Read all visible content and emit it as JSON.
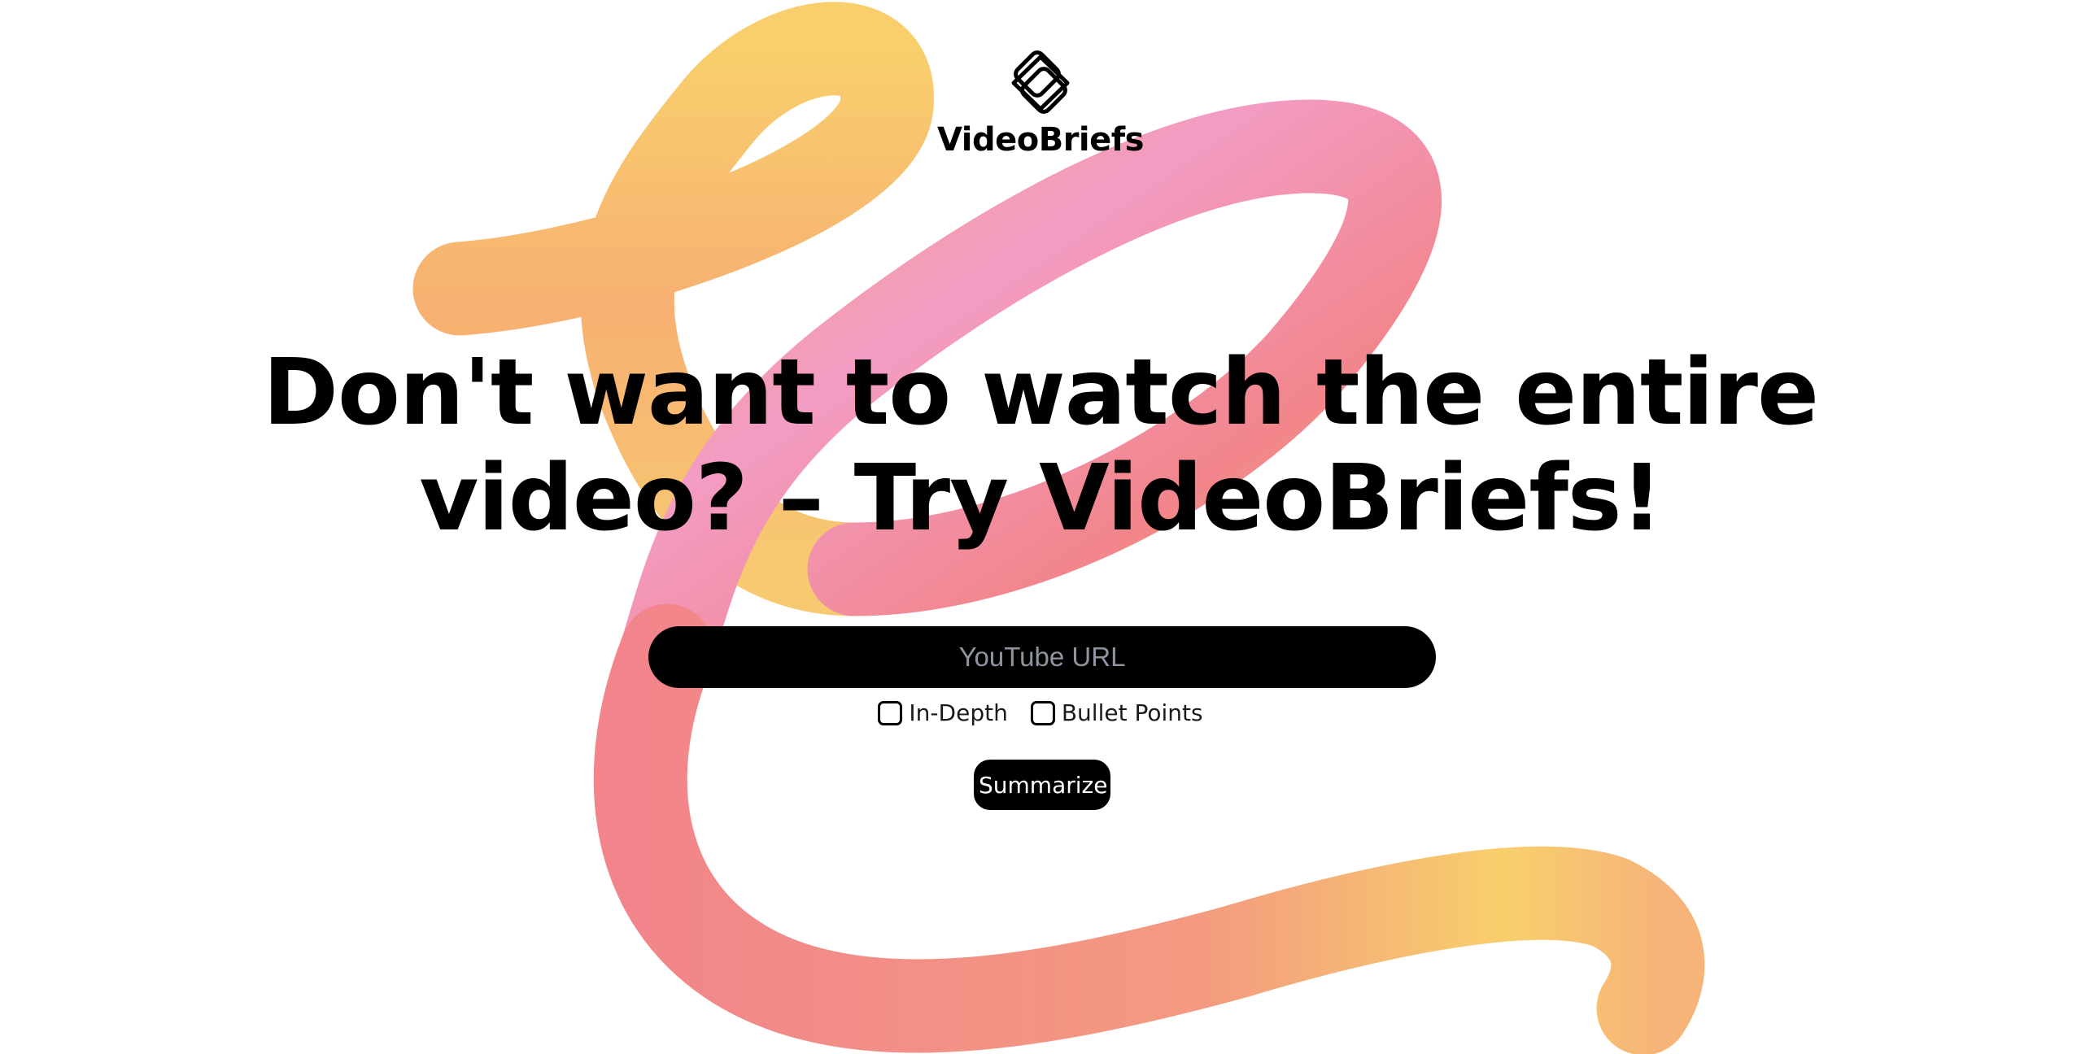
{
  "brand": {
    "logo_icon": "linked-diamonds-logo-icon",
    "name": "VideoBriefs"
  },
  "hero": {
    "headline_line1": "Don't want to watch the entire",
    "headline_line2": "video? – Try VideoBriefs!"
  },
  "form": {
    "url_placeholder": "YouTube URL",
    "url_value": "",
    "options": [
      {
        "label": "In-Depth",
        "checked": false
      },
      {
        "label": "Bullet Points",
        "checked": false
      }
    ],
    "submit_label": "Summarize"
  },
  "colors": {
    "gradient_yellow": "#f8cf6c",
    "gradient_orange": "#f6a27f",
    "gradient_pink": "#f39cc4",
    "gradient_coral": "#f2858b",
    "text": "#000000",
    "input_bg": "#000000",
    "placeholder": "#8f95a0"
  }
}
